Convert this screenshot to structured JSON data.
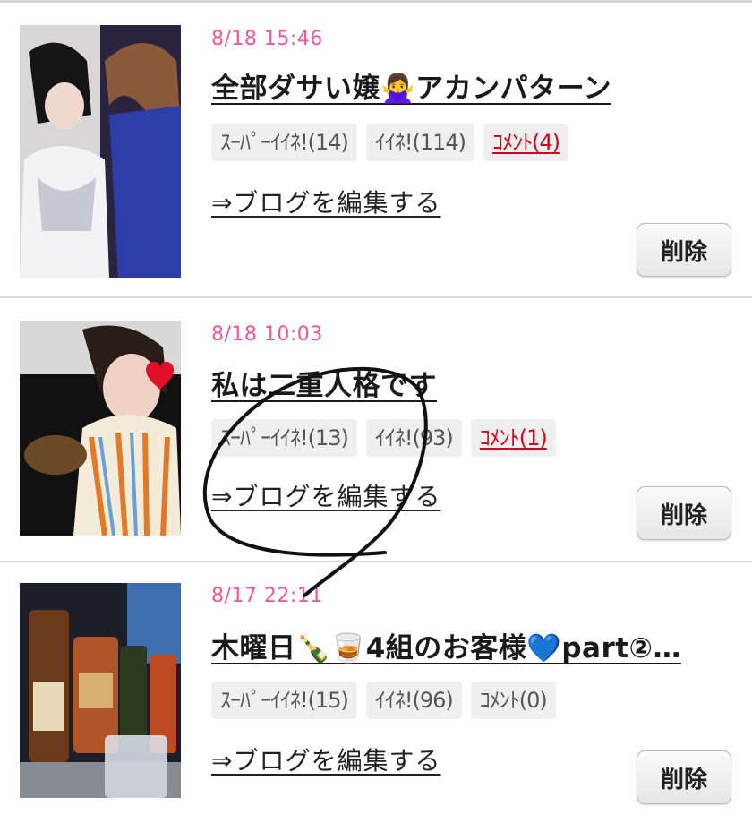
{
  "entries": [
    {
      "date": "8/18 15:46",
      "title": "全部ダサい嬢🙅‍♀️アカンパターン",
      "super_likes": "ｽｰﾊﾟｰｲｲﾈ!(14)",
      "likes": "ｲｲﾈ!(114)",
      "comments": "ｺﾒﾝﾄ(4)",
      "edit_link": "⇒ブログを編集する",
      "delete_label": "削除"
    },
    {
      "date": "8/18 10:03",
      "title": "私は二重人格です",
      "super_likes": "ｽｰﾊﾟｰｲｲﾈ!(13)",
      "likes": "ｲｲﾈ!(93)",
      "comments": "ｺﾒﾝﾄ(1)",
      "edit_link": "⇒ブログを編集する",
      "delete_label": "削除"
    },
    {
      "date": "8/17 22:11",
      "title": "木曜日🍾🥃4組のお客様💙part②…",
      "super_likes": "ｽｰﾊﾟｰｲｲﾈ!(15)",
      "likes": "ｲｲﾈ!(96)",
      "comments": "ｺﾒﾝﾄ(0)",
      "edit_link": "⇒ブログを編集する",
      "delete_label": "削除"
    }
  ],
  "colors": {
    "date": "#e8589c",
    "comment_active": "#d4001a",
    "badge_bg": "#efefef",
    "divider": "#d7d7d7"
  }
}
